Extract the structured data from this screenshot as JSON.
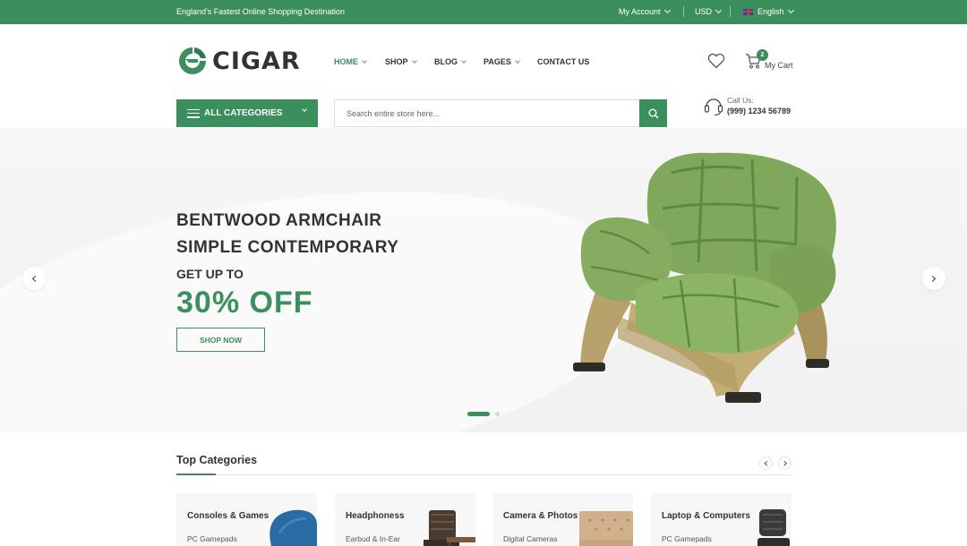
{
  "topbar": {
    "tagline": "England's Fastest Online Shopping Destination",
    "account": "My Account",
    "currency": "USD",
    "language": "English"
  },
  "brand": {
    "name": "CIGAR",
    "accent_color": "#3a8f5c"
  },
  "nav": {
    "items": [
      {
        "label": "HOME"
      },
      {
        "label": "SHOP"
      },
      {
        "label": "BLOG"
      },
      {
        "label": "PAGES"
      },
      {
        "label": "CONTACT US"
      }
    ]
  },
  "header": {
    "cart_count": "2",
    "cart_label": "My Cart",
    "call_label": "Call Us:",
    "call_number": "(999) 1234 56789"
  },
  "search": {
    "categories_label": "ALL CATEGORIES",
    "placeholder": "Search entire store here..."
  },
  "hero": {
    "line1": "BENTWOOD ARMCHAIR",
    "line2": "SIMPLE CONTEMPORARY",
    "line3": "GET UP TO",
    "offer": "30% OFF",
    "button": "SHOP NOW"
  },
  "top_categories": {
    "title": "Top Categories",
    "cards": [
      {
        "name": "Consoles & Games",
        "sub": "PC Gamepads"
      },
      {
        "name": "Headphoness",
        "sub": "Earbud & In-Ear"
      },
      {
        "name": "Camera & Photos",
        "sub": "Digital Cameras"
      },
      {
        "name": "Laptop & Computers",
        "sub": "PC Gamepads"
      }
    ]
  }
}
